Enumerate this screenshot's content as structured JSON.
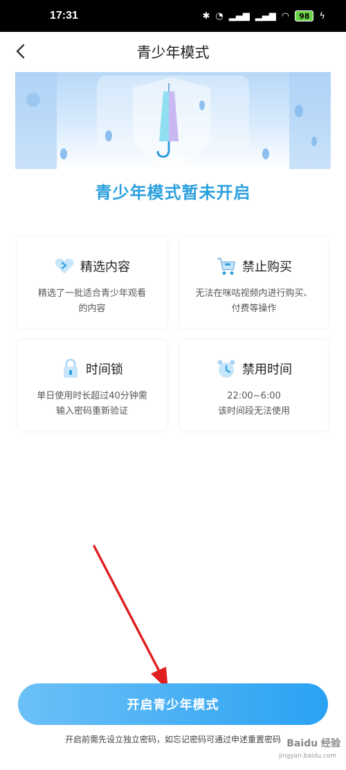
{
  "status": {
    "time": "17:31",
    "battery": "98"
  },
  "header": {
    "title": "青少年模式"
  },
  "hero": {
    "title": "青少年模式暂未开启"
  },
  "features": [
    {
      "title": "精选内容",
      "desc": "精选了一批适合青少年观看\n的内容",
      "icon": "heart-icon"
    },
    {
      "title": "禁止购买",
      "desc": "无法在咪咕视频内进行购买、\n付费等操作",
      "icon": "shopping-cart-icon"
    },
    {
      "title": "时间锁",
      "desc": "单日使用时长超过40分钟需\n输入密码重新验证",
      "icon": "lock-icon"
    },
    {
      "title": "禁用时间",
      "desc": "22:00~6:00\n该时间段无法使用",
      "icon": "alarm-clock-icon"
    }
  ],
  "action": {
    "enable_label": "开启青少年模式"
  },
  "footer": {
    "note": "开启前需先设立独立密码，如忘记密码可通过申述重置密码"
  },
  "watermark": {
    "brand": "Baidu 经验",
    "url": "jingyan.baidu.com"
  },
  "colors": {
    "accent": "#2aa0dd",
    "button": "#2aa2f3",
    "annotation": "#e02020"
  }
}
